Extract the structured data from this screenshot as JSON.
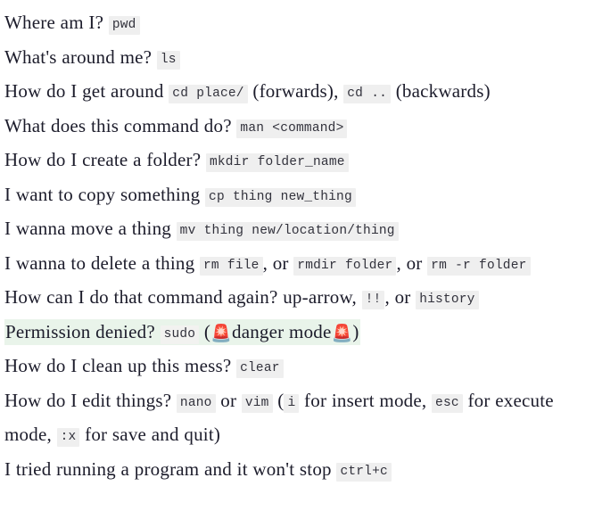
{
  "document": {
    "background_color": "#ffffff",
    "text_color": "#1c1c2b",
    "code_background_color": "#efefef",
    "highlight_color": "#e9f4ea",
    "emoji_color": "#e02020",
    "lines": [
      {
        "id": "pwd",
        "question": "Where am I?",
        "codes": [
          "pwd"
        ],
        "highlighted": false
      },
      {
        "id": "ls",
        "question": "What's around me?",
        "codes": [
          "ls"
        ],
        "highlighted": false
      },
      {
        "id": "cd",
        "question": "How do I get around",
        "codes": [
          "cd place/",
          "cd .."
        ],
        "parts": {
          "forwards": "(forwards),",
          "backwards": "(backwards)"
        },
        "highlighted": false
      },
      {
        "id": "man",
        "question": "What does this command do?",
        "codes": [
          "man <command>"
        ],
        "highlighted": false
      },
      {
        "id": "mkdir",
        "question": "How do I create a folder?",
        "codes": [
          "mkdir folder_name"
        ],
        "highlighted": false
      },
      {
        "id": "cp",
        "question": "I want to copy something",
        "codes": [
          "cp thing new_thing"
        ],
        "highlighted": false
      },
      {
        "id": "mv",
        "question": "I wanna move a thing",
        "codes": [
          "mv thing new/location/thing"
        ],
        "highlighted": false
      },
      {
        "id": "rm",
        "question": "I wanna to delete a thing",
        "codes": [
          "rm file",
          "rmdir folder",
          "rm -r folder"
        ],
        "parts": {
          "sep1": ", or",
          "sep2": ", or"
        },
        "highlighted": false
      },
      {
        "id": "history",
        "question": "How can I do that command again? up-arrow,",
        "codes": [
          "!!",
          "history"
        ],
        "parts": {
          "sep1": ", or"
        },
        "highlighted": false
      },
      {
        "id": "sudo",
        "question": "Permission denied?",
        "codes": [
          "sudo"
        ],
        "parts": {
          "open_paren": "(",
          "danger_label": "danger mode",
          "close_paren": ")",
          "emoji_left": "🚨",
          "emoji_right": "🚨"
        },
        "highlighted": true
      },
      {
        "id": "clear",
        "question": "How do I clean up this mess?",
        "codes": [
          "clear"
        ],
        "highlighted": false
      },
      {
        "id": "editors",
        "question": "How do I edit things?",
        "codes": [
          "nano",
          "vim",
          "i",
          "esc",
          ":x"
        ],
        "parts": {
          "or": "or",
          "open_paren": "(",
          "insert": "for insert mode,",
          "execute": "for execute mode,",
          "save": "for save and quit)"
        },
        "highlighted": false
      },
      {
        "id": "ctrlc",
        "question": "I tried running a program and it won't stop",
        "codes": [
          "ctrl+c"
        ],
        "highlighted": false
      }
    ]
  }
}
